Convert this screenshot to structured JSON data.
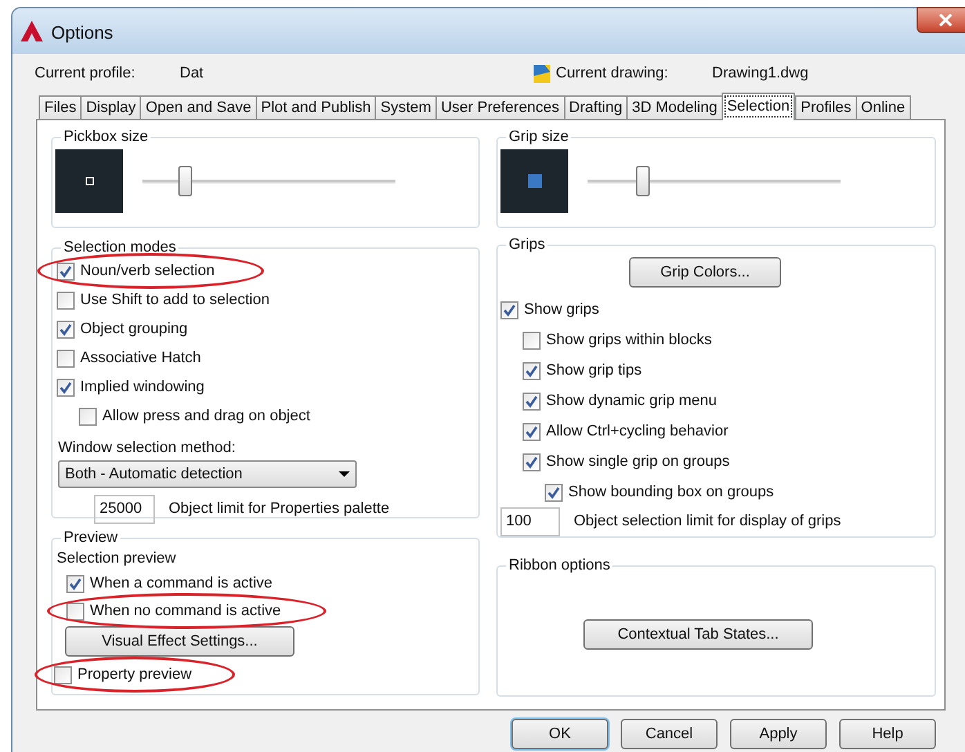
{
  "window": {
    "title": "Options"
  },
  "header": {
    "profile_label": "Current profile:",
    "profile": "Dat",
    "drawing_label": "Current drawing:",
    "drawing": "Drawing1.dwg"
  },
  "tabs": [
    {
      "label": "Files",
      "selected": false
    },
    {
      "label": "Display",
      "selected": false
    },
    {
      "label": "Open and Save",
      "selected": false
    },
    {
      "label": "Plot and Publish",
      "selected": false
    },
    {
      "label": "System",
      "selected": false
    },
    {
      "label": "User Preferences",
      "selected": false
    },
    {
      "label": "Drafting",
      "selected": false
    },
    {
      "label": "3D Modeling",
      "selected": false
    },
    {
      "label": "Selection",
      "selected": true
    },
    {
      "label": "Profiles",
      "selected": false
    },
    {
      "label": "Online",
      "selected": false
    }
  ],
  "pickbox": {
    "title": "Pickbox size",
    "level": 0.17
  },
  "selection_modes": {
    "title": "Selection modes",
    "options": [
      {
        "label": "Noun/verb selection",
        "checked": true,
        "highlighted": true
      },
      {
        "label": "Use Shift to add to selection",
        "checked": false,
        "highlighted": false
      },
      {
        "label": "Object grouping",
        "checked": true,
        "highlighted": false
      },
      {
        "label": "Associative Hatch",
        "checked": false,
        "highlighted": false
      },
      {
        "label": "Implied windowing",
        "checked": true,
        "highlighted": false,
        "children": [
          {
            "label": "Allow press and drag on object",
            "checked": false,
            "highlighted": false
          }
        ]
      }
    ],
    "method_label": "Window selection method:",
    "method": "Both - Automatic detection",
    "limit": "25000",
    "limit_label": "Object limit for Properties palette"
  },
  "preview": {
    "title": "Preview",
    "subtitle": "Selection preview",
    "options": [
      {
        "label": "When a command is active",
        "checked": true,
        "highlighted": false
      },
      {
        "label": "When no command is active",
        "checked": false,
        "highlighted": true
      }
    ],
    "button": "Visual Effect Settings...",
    "property_preview": {
      "label": "Property preview",
      "checked": false,
      "highlighted": true
    }
  },
  "grip_size": {
    "title": "Grip size",
    "level": 0.22
  },
  "grips": {
    "title": "Grips",
    "button": "Grip Colors...",
    "options": [
      {
        "label": "Show grips",
        "checked": true,
        "highlighted": false,
        "children": [
          {
            "label": "Show grips within blocks",
            "checked": false,
            "highlighted": false
          },
          {
            "label": "Show grip tips",
            "checked": true,
            "highlighted": false
          },
          {
            "label": "Show dynamic grip menu",
            "checked": true,
            "highlighted": false
          },
          {
            "label": "Allow Ctrl+cycling behavior",
            "checked": true,
            "highlighted": false
          },
          {
            "label": "Show single grip on groups",
            "checked": true,
            "highlighted": false,
            "children": [
              {
                "label": "Show bounding box on groups",
                "checked": true,
                "highlighted": false
              }
            ]
          }
        ]
      }
    ],
    "limit": "100",
    "limit_label": "Object selection limit for display of grips"
  },
  "ribbon": {
    "title": "Ribbon options",
    "button": "Contextual Tab States..."
  },
  "buttons": [
    {
      "label": "OK",
      "default": true
    },
    {
      "label": "Cancel",
      "default": false
    },
    {
      "label": "Apply",
      "default": false
    },
    {
      "label": "Help",
      "default": false
    }
  ]
}
